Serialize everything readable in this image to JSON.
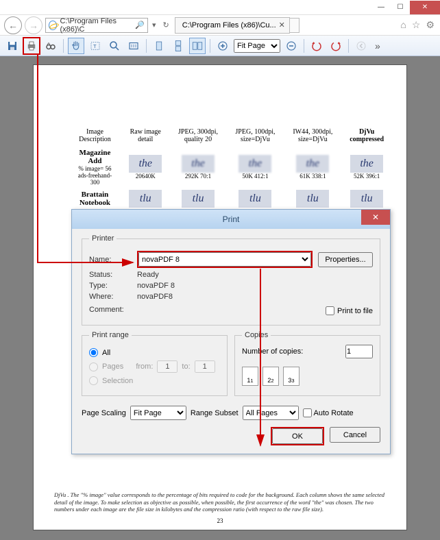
{
  "window": {
    "address": "C:\\Program Files (x86)\\C",
    "tab_label": "C:\\Program Files (x86)\\Cu..."
  },
  "toolbar": {
    "zoom_value": "Fit Page"
  },
  "document": {
    "columns": [
      "Image Description",
      "Raw image detail",
      "JPEG, 300dpi, quality 20",
      "JPEG, 100dpi, size=DjVu",
      "IW44, 300dpi, size=DjVu",
      "DjVu compressed"
    ],
    "rows": [
      {
        "label_bold": "Magazine Add",
        "label_sub1": "% image= 56",
        "label_sub2": "ads-freehand-300",
        "cells": [
          "20640K",
          "292K 70:1",
          "50K 412:1",
          "61K 338:1",
          "52K 396:1"
        ]
      },
      {
        "label_bold": "Brattain Notebook",
        "label_sub1": "",
        "label_sub2": "",
        "cells": [
          "",
          "",
          "",
          "",
          ""
        ]
      }
    ],
    "footnote": "DjVu . The \"% image\" value corresponds to the percentage of bits required to code for the background. Each column shows the same selected detail of the image. To make selection as objective as possible, when possible, the first occurrence of the word \"the\" was chosen. The two numbers under each image are the file size in kilobytes and the compression ratio (with respect to the raw file size).",
    "page_number": "23"
  },
  "dialog": {
    "title": "Print",
    "printer_legend": "Printer",
    "name_label": "Name:",
    "name_value": "novaPDF 8",
    "properties_btn": "Properties...",
    "status_label": "Status:",
    "status_value": "Ready",
    "type_label": "Type:",
    "type_value": "novaPDF 8",
    "where_label": "Where:",
    "where_value": "novaPDF8",
    "comment_label": "Comment:",
    "print_to_file": "Print to file",
    "range_legend": "Print range",
    "range_all": "All",
    "range_pages": "Pages",
    "range_from": "from:",
    "range_from_val": "1",
    "range_to": "to:",
    "range_to_val": "1",
    "range_selection": "Selection",
    "copies_legend": "Copies",
    "copies_label": "Number of copies:",
    "copies_value": "1",
    "collate_pages": [
      "1",
      "2",
      "3"
    ],
    "page_scaling_label": "Page Scaling",
    "page_scaling_value": "Fit Page",
    "range_subset_label": "Range Subset",
    "range_subset_value": "All Pages",
    "auto_rotate": "Auto Rotate",
    "ok": "OK",
    "cancel": "Cancel"
  }
}
